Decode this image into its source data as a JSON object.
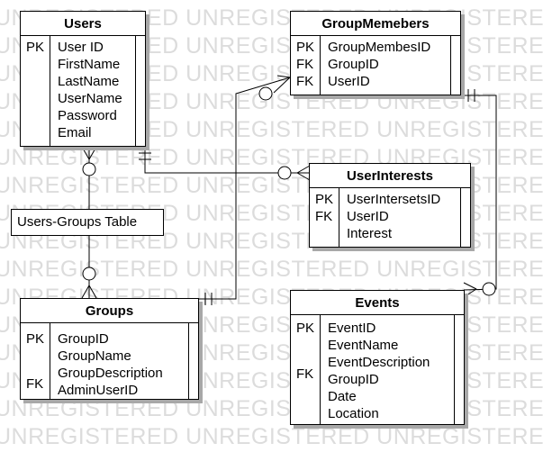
{
  "watermark": {
    "text": "UNREGISTERED"
  },
  "label_box": {
    "text": "Users-Groups Table"
  },
  "tables": {
    "users": {
      "title": "Users",
      "keys": [
        "PK"
      ],
      "fields": [
        "User ID",
        "FirstName",
        "LastName",
        "UserName",
        "Password",
        "Email"
      ]
    },
    "group_members": {
      "title": "GroupMemebers",
      "keys": [
        "PK",
        "FK",
        "FK"
      ],
      "fields": [
        "GroupMembesID",
        "GroupID",
        "UserID"
      ]
    },
    "user_interests": {
      "title": "UserInterests",
      "keys": [
        "PK",
        "FK"
      ],
      "fields": [
        "UserIntersetsID",
        "UserID",
        "Interest"
      ]
    },
    "groups": {
      "title": "Groups",
      "keys": [
        "PK",
        "FK"
      ],
      "fields": [
        "GroupID",
        "GroupName",
        "GroupDescription",
        "AdminUserID"
      ]
    },
    "events": {
      "title": "Events",
      "keys": [
        "PK",
        "FK"
      ],
      "fields": [
        "EventID",
        "EventName",
        "EventDescription",
        "GroupID",
        "Date",
        "Location"
      ]
    }
  }
}
